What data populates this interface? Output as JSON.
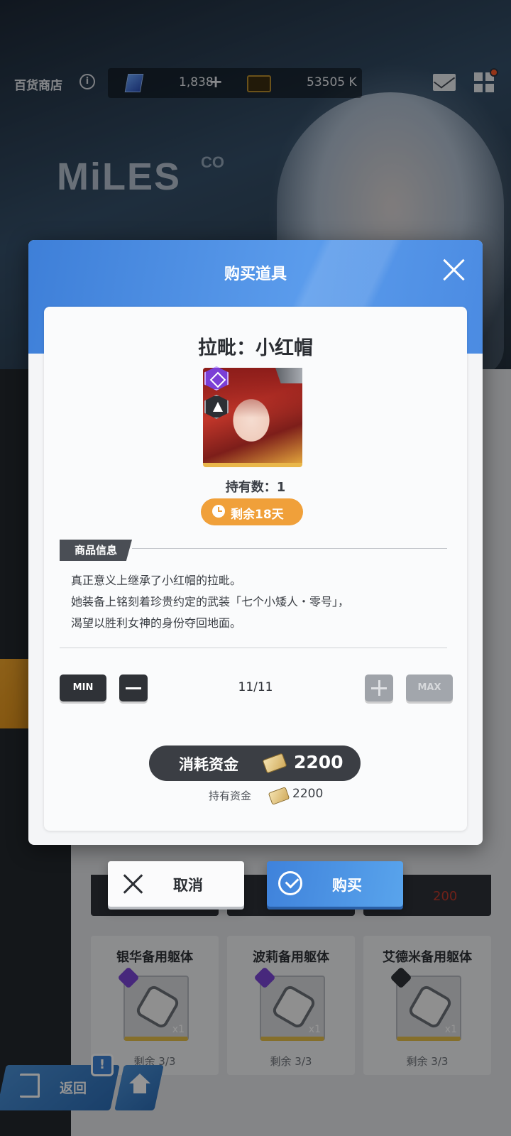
{
  "header": {
    "shop_title": "百货商店",
    "info_glyph": "i",
    "gems": "1,838",
    "gems_plus": "+",
    "credits": "53505 K",
    "logo": "MiLES",
    "logo_suffix": "CO"
  },
  "modal": {
    "title": "购买道具",
    "item_name": "拉毗：小红帽",
    "held_count": "持有数：1",
    "timer": "剩余18天",
    "section_tag": "商品信息",
    "description": [
      "真正意义上继承了小红帽的拉毗。",
      "她装备上铭刻着珍贵约定的武装「七个小矮人・零号」，",
      "渴望以胜利女神的身份夺回地面。"
    ],
    "quantity": {
      "min_label": "MIN",
      "max_label": "MAX",
      "value": "11/11"
    },
    "cost": {
      "label": "消耗资金",
      "value": "2200"
    },
    "funds": {
      "label": "持有资金",
      "value": "2200"
    }
  },
  "actions": {
    "cancel_label": "取消",
    "buy_label": "购买"
  },
  "background_cards": [
    {
      "name": "银华备用躯体",
      "qty": "x1",
      "remaining": "剩余 3/3"
    },
    {
      "name": "波莉备用躯体",
      "qty": "x1",
      "remaining": "剩余 3/3"
    },
    {
      "name": "艾德米备用躯体",
      "qty": "x1",
      "remaining": "剩余 3/3"
    }
  ],
  "background_price": "200",
  "bottom_nav": {
    "back_label": "返回",
    "alert_glyph": "!"
  },
  "colors": {
    "accent_blue": "#4b8be2",
    "timer_orange": "#f0a03a",
    "dark_button": "#2f3237"
  }
}
